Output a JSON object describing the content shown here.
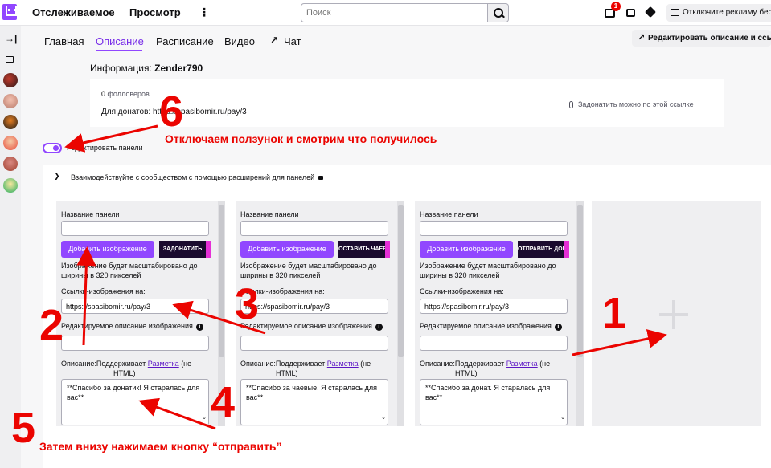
{
  "nav": {
    "following": "Отслеживаемое",
    "browse": "Просмотр",
    "more": "⋮",
    "search_placeholder": "Поиск",
    "notification_count": "1",
    "ad_free": "Отключите рекламу беспл"
  },
  "tabs": [
    {
      "label": "Главная"
    },
    {
      "label": "Описание"
    },
    {
      "label": "Расписание"
    },
    {
      "label": "Видео"
    },
    {
      "label": "Чат"
    }
  ],
  "edit_description_button": "Редактировать описание и ссылки",
  "info": {
    "title_prefix": "Информация: ",
    "channel_name": "Zender790",
    "followers_count": "0",
    "followers_label": "фолловеров",
    "donate_line": "Для донатов: https://spasibomir.ru/pay/3",
    "donate_right": "Задонатить можно по этой ссылке"
  },
  "edit_panels_label": "Редактировать панели",
  "extensions_label": "Взаимодействуйте с сообществом с помощью расширений для панелей",
  "panel_labels": {
    "name": "Название панели",
    "add_image": "Добавить изображение",
    "image_note_1": "Изображение будет масштабировано до",
    "image_note_2": "ширины в 320 пикселей",
    "image_links": "Ссылки-изображения на:",
    "image_desc": "Редактируемое описание изображения",
    "desc_prefix": "Описание:",
    "desc_supports": "Поддерживает ",
    "desc_markdown": "Разметка",
    "desc_not_html": " (не",
    "desc_html": "HTML)"
  },
  "panels": [
    {
      "promo": "ЗАДОНАТИТЬ",
      "link": "https://spasibomir.ru/pay/3",
      "description": "**Спасибо за донатик! Я старалась для вас**"
    },
    {
      "promo": "ОСТАВИТЬ ЧАЕВЫЕ",
      "link": "https://spasibomir.ru/pay/3",
      "description": "**Спасибо за чаевые. Я старалась для вас**"
    },
    {
      "promo": "ОТПРАВИТЬ ДОНАТ",
      "link": "https://spasibomir.ru/pay/3",
      "description": "**Спасибо за донат. Я старалась для вас**"
    }
  ],
  "annotations": {
    "n1": "1",
    "n2": "2",
    "n3": "3",
    "n4": "4",
    "n5": "5",
    "n6": "6",
    "text6": "Отключаем ползунок и смотрим что получилось",
    "text5": "Затем внизу нажимаем кнопку “отправить”"
  },
  "colors": {
    "accent": "#9147ff",
    "annotation": "#eb0400"
  }
}
